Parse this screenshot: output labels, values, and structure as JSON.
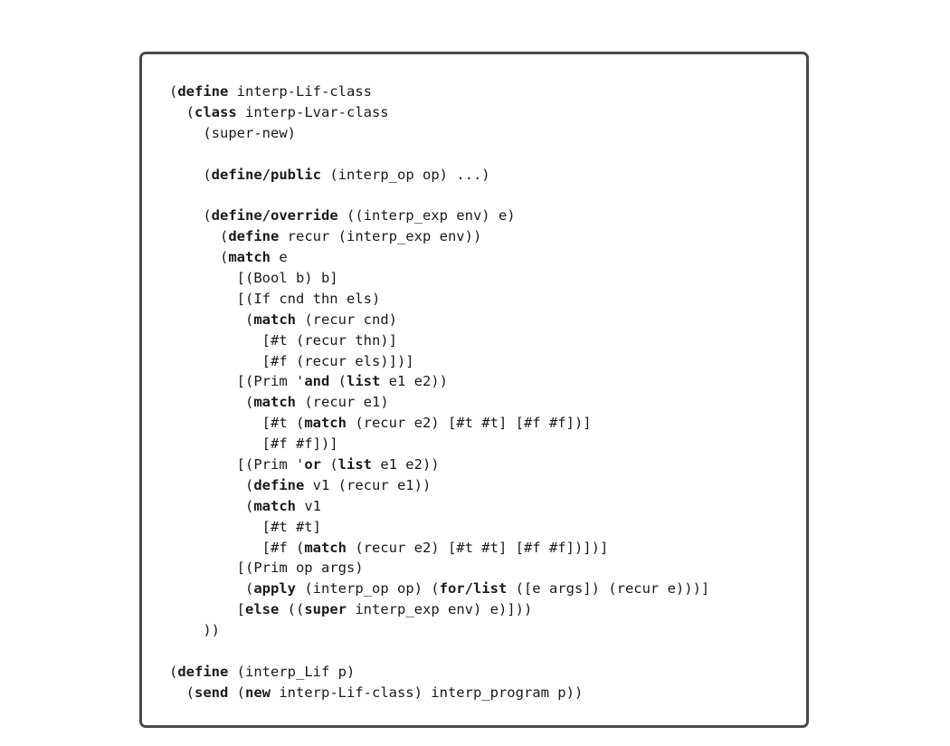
{
  "code": {
    "lines": [
      [
        {
          "t": "("
        },
        {
          "t": "define",
          "b": true
        },
        {
          "t": " interp-Lif-class"
        }
      ],
      [
        {
          "t": "  ("
        },
        {
          "t": "class",
          "b": true
        },
        {
          "t": " interp-Lvar-class"
        }
      ],
      [
        {
          "t": "    (super-new)"
        }
      ],
      [
        {
          "t": ""
        }
      ],
      [
        {
          "t": "    ("
        },
        {
          "t": "define/public",
          "b": true
        },
        {
          "t": " (interp_op op) ...)"
        }
      ],
      [
        {
          "t": ""
        }
      ],
      [
        {
          "t": "    ("
        },
        {
          "t": "define/override",
          "b": true
        },
        {
          "t": " ((interp_exp env) e)"
        }
      ],
      [
        {
          "t": "      ("
        },
        {
          "t": "define",
          "b": true
        },
        {
          "t": " recur (interp_exp env))"
        }
      ],
      [
        {
          "t": "      ("
        },
        {
          "t": "match",
          "b": true
        },
        {
          "t": " e"
        }
      ],
      [
        {
          "t": "        [(Bool b) b]"
        }
      ],
      [
        {
          "t": "        [(If cnd thn els)"
        }
      ],
      [
        {
          "t": "         ("
        },
        {
          "t": "match",
          "b": true
        },
        {
          "t": " (recur cnd)"
        }
      ],
      [
        {
          "t": "           [#t (recur thn)]"
        }
      ],
      [
        {
          "t": "           [#f (recur els)])]"
        }
      ],
      [
        {
          "t": "        [(Prim '"
        },
        {
          "t": "and",
          "b": true
        },
        {
          "t": " ("
        },
        {
          "t": "list",
          "b": true
        },
        {
          "t": " e1 e2))"
        }
      ],
      [
        {
          "t": "         ("
        },
        {
          "t": "match",
          "b": true
        },
        {
          "t": " (recur e1)"
        }
      ],
      [
        {
          "t": "           [#t ("
        },
        {
          "t": "match",
          "b": true
        },
        {
          "t": " (recur e2) [#t #t] [#f #f])]"
        }
      ],
      [
        {
          "t": "           [#f #f])]"
        }
      ],
      [
        {
          "t": "        [(Prim '"
        },
        {
          "t": "or",
          "b": true
        },
        {
          "t": " ("
        },
        {
          "t": "list",
          "b": true
        },
        {
          "t": " e1 e2))"
        }
      ],
      [
        {
          "t": "         ("
        },
        {
          "t": "define",
          "b": true
        },
        {
          "t": " v1 (recur e1))"
        }
      ],
      [
        {
          "t": "         ("
        },
        {
          "t": "match",
          "b": true
        },
        {
          "t": " v1"
        }
      ],
      [
        {
          "t": "           [#t #t]"
        }
      ],
      [
        {
          "t": "           [#f ("
        },
        {
          "t": "match",
          "b": true
        },
        {
          "t": " (recur e2) [#t #t] [#f #f])])]"
        }
      ],
      [
        {
          "t": "        [(Prim op args)"
        }
      ],
      [
        {
          "t": "         ("
        },
        {
          "t": "apply",
          "b": true
        },
        {
          "t": " (interp_op op) ("
        },
        {
          "t": "for/list",
          "b": true
        },
        {
          "t": " ([e args]) (recur e)))]"
        }
      ],
      [
        {
          "t": "        ["
        },
        {
          "t": "else",
          "b": true
        },
        {
          "t": " (("
        },
        {
          "t": "super",
          "b": true
        },
        {
          "t": " interp_exp env) e)]))"
        }
      ],
      [
        {
          "t": "    ))"
        }
      ],
      [
        {
          "t": ""
        }
      ],
      [
        {
          "t": "("
        },
        {
          "t": "define",
          "b": true
        },
        {
          "t": " (interp_Lif p)"
        }
      ],
      [
        {
          "t": "  ("
        },
        {
          "t": "send",
          "b": true
        },
        {
          "t": " ("
        },
        {
          "t": "new",
          "b": true
        },
        {
          "t": " interp-Lif-class) interp_program p))"
        }
      ]
    ]
  }
}
